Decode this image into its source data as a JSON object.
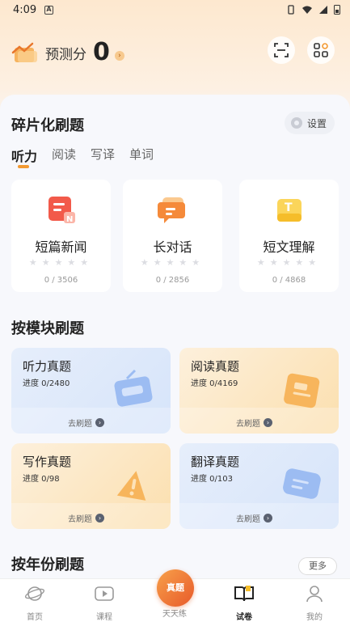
{
  "status": {
    "time": "4:09",
    "notif": "A",
    "icons": "▯ ▾ ▾ ▮"
  },
  "score": {
    "label": "预测分",
    "value": "0",
    "arrow": "›"
  },
  "section1": {
    "title": "碎片化刷题",
    "settings_label": "设置",
    "tabs": [
      "听力",
      "阅读",
      "写译",
      "单词"
    ],
    "cards": [
      {
        "title": "短篇新闻",
        "stars": "★★★★★",
        "progress": "0 / 3506"
      },
      {
        "title": "长对话",
        "stars": "★★★★★",
        "progress": "0 / 2856"
      },
      {
        "title": "短文理解",
        "stars": "★★★★★",
        "progress": "0 / 4868"
      }
    ]
  },
  "section2": {
    "title": "按模块刷题",
    "modules": [
      {
        "title": "听力真题",
        "progress": "进度 0/2480",
        "action": "去刷题"
      },
      {
        "title": "阅读真题",
        "progress": "进度 0/4169",
        "action": "去刷题"
      },
      {
        "title": "写作真题",
        "progress": "进度 0/98",
        "action": "去刷题"
      },
      {
        "title": "翻译真题",
        "progress": "进度 0/103",
        "action": "去刷题"
      }
    ]
  },
  "section3": {
    "title": "按年份刷题",
    "more": "更多"
  },
  "nav": {
    "items": [
      "首页",
      "课程",
      "天天练",
      "试卷",
      "我的"
    ],
    "center_badge": "真题"
  },
  "colors": {
    "accent": "#f39a32",
    "blue_card": "#dce7fb",
    "orange_card": "#fce5bd"
  }
}
